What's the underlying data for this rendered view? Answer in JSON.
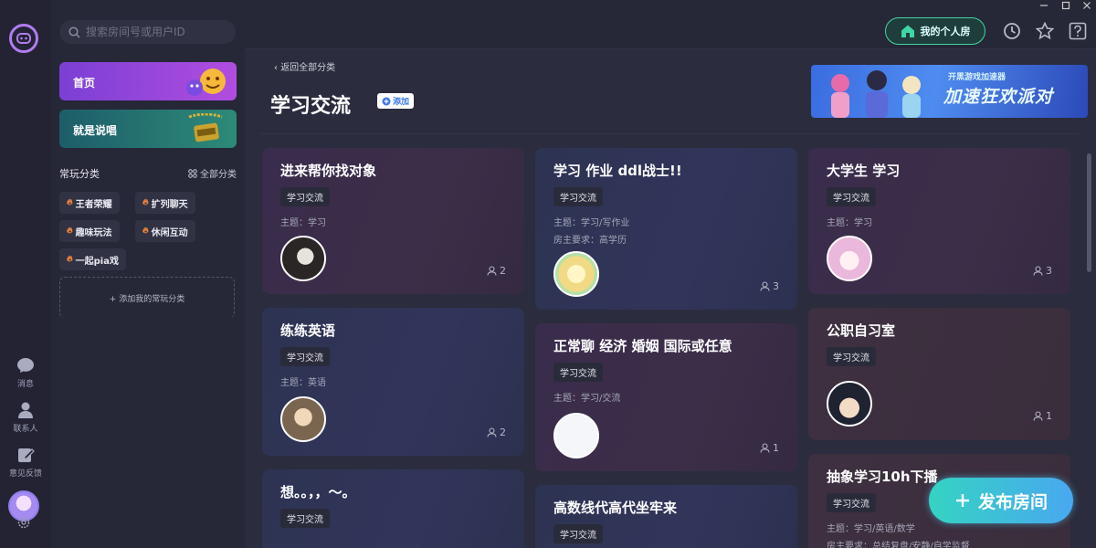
{
  "rail": {
    "messages": "消息",
    "contacts": "联系人",
    "feedback": "意见反馈"
  },
  "sidebar": {
    "search_placeholder": "搜索房间号或用户ID",
    "nav": [
      {
        "label": "首页"
      },
      {
        "label": "就是说唱"
      }
    ],
    "section_title": "常玩分类",
    "all_categories": "全部分类",
    "chips": [
      "王者荣耀",
      "扩列聊天",
      "趣味玩法",
      "休闲互动",
      "一起pia戏"
    ],
    "add_category": "+ 添加我的常玩分类"
  },
  "topbar": {
    "my_room": "我的个人房"
  },
  "main": {
    "back": "返回全部分类",
    "title": "学习交流",
    "add_badge": "添加",
    "banner_small": "开黑游戏加速器",
    "banner_big": "加速狂欢派对"
  },
  "rooms": [
    {
      "title": "进来帮你找对象",
      "tag": "学习交流",
      "meta": [
        "主题：学习"
      ],
      "count": "2"
    },
    {
      "title": "学习 作业 ddl战士!!",
      "tag": "学习交流",
      "meta": [
        "主题：学习/写作业",
        "房主要求：高学历"
      ],
      "count": "3"
    },
    {
      "title": "大学生 学习",
      "tag": "学习交流",
      "meta": [
        "主题：学习"
      ],
      "count": "3"
    },
    {
      "title": "练练英语",
      "tag": "学习交流",
      "meta": [
        "主题：英语"
      ],
      "count": "2"
    },
    {
      "title": "正常聊 经济 婚姻 国际或任意",
      "tag": "学习交流",
      "meta": [
        "主题：学习/交流"
      ],
      "count": "1"
    },
    {
      "title": "公职自习室",
      "tag": "学习交流",
      "meta": [],
      "count": "1"
    },
    {
      "title": "想。。，，～。",
      "tag": "学习交流",
      "meta": [],
      "count": ""
    },
    {
      "title": "高数线代高代坐牢来",
      "tag": "学习交流",
      "meta": [],
      "count": ""
    },
    {
      "title": "抽象学习10h下播",
      "tag": "学习交流",
      "meta": [
        "主题：学习/英语/数学",
        "房主要求：总结复盘/安静/自学监督"
      ],
      "count": ""
    }
  ],
  "publish_label": "发布房间",
  "colors": {
    "accent": "#3fd6a6",
    "publish_start": "#35d3c2",
    "publish_end": "#48a8f0"
  }
}
